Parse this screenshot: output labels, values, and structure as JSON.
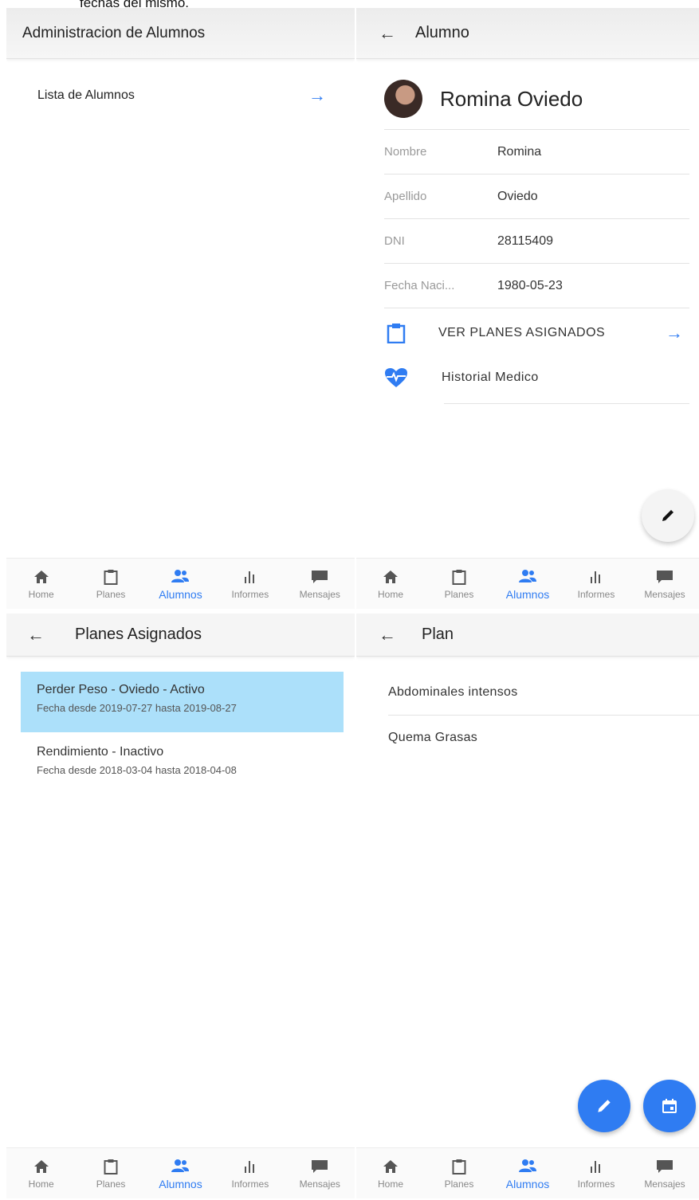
{
  "caption": "fechas del mismo.",
  "accent_color": "#2f7cf2",
  "selected_color": "#ace0fa",
  "panel1": {
    "title": "Administracion de Alumnos",
    "list": [
      {
        "label": "Lista de Alumnos",
        "icon": "arrow-right-icon"
      }
    ]
  },
  "panel2": {
    "title": "Alumno",
    "student_name": "Romina Oviedo",
    "fields": [
      {
        "label": "Nombre",
        "value": "Romina"
      },
      {
        "label": "Apellido",
        "value": "Oviedo"
      },
      {
        "label": "DNI",
        "value": "28115409"
      },
      {
        "label": "Fecha Naci...",
        "value": "1980-05-23"
      }
    ],
    "actions": [
      {
        "label": "VER PLANES ASIGNADOS",
        "icon": "clipboard-icon"
      },
      {
        "label": "Historial Medico",
        "icon": "heart-pulse-icon"
      }
    ]
  },
  "panel3": {
    "title": "Planes Asignados",
    "plans": [
      {
        "title": "Perder Peso - Oviedo - Activo",
        "dates": "Fecha desde 2019-07-27 hasta 2019-08-27",
        "selected": true
      },
      {
        "title": "Rendimiento - Inactivo",
        "dates": "Fecha desde 2018-03-04 hasta 2018-04-08",
        "selected": false
      }
    ]
  },
  "panel4": {
    "title": "Plan",
    "exercises": [
      "Abdominales intensos",
      "Quema Grasas"
    ]
  },
  "nav": {
    "items": [
      {
        "label": "Home",
        "icon": "home-icon"
      },
      {
        "label": "Planes",
        "icon": "clipboard-icon"
      },
      {
        "label": "Alumnos",
        "icon": "students-icon"
      },
      {
        "label": "Informes",
        "icon": "bar-chart-icon"
      },
      {
        "label": "Mensajes",
        "icon": "chat-icon"
      }
    ],
    "active_index": 2
  }
}
